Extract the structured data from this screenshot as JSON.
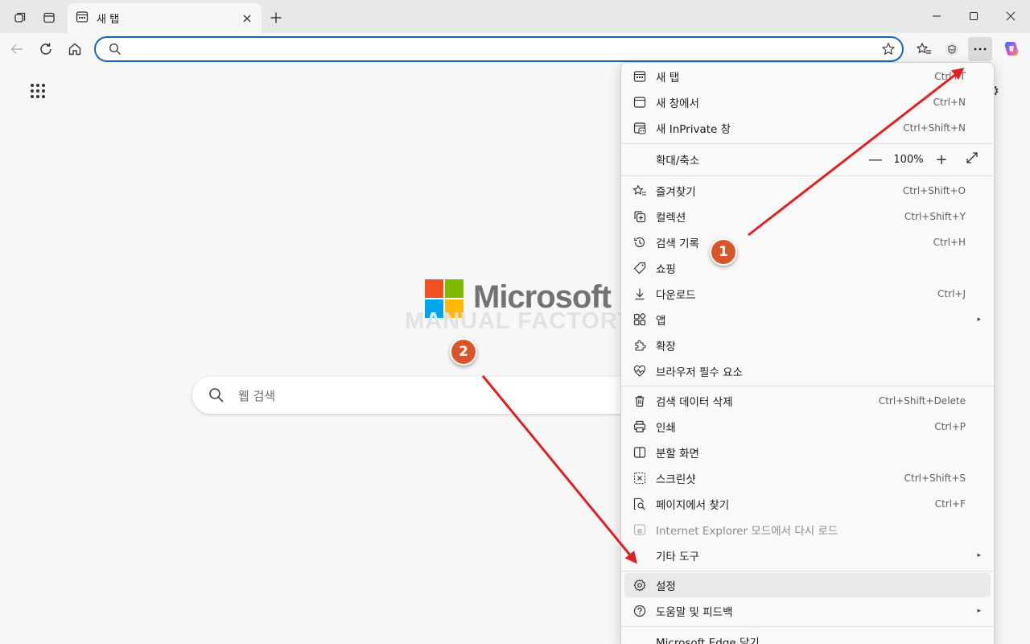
{
  "tab": {
    "title": "새 탭"
  },
  "omnibox": {
    "value": "",
    "placeholder": ""
  },
  "content": {
    "logo_text": "Microsoft",
    "watermark": "MANUAL FACTORY",
    "search_placeholder": "웹 검색"
  },
  "menu": {
    "items": [
      {
        "label": "새 탭",
        "shortcut": "Ctrl+T",
        "icon": "new-tab-icon"
      },
      {
        "label": "새 창에서",
        "shortcut": "Ctrl+N",
        "icon": "new-window-icon"
      },
      {
        "label": "새 InPrivate 창",
        "shortcut": "Ctrl+Shift+N",
        "icon": "inprivate-icon"
      },
      {
        "label": "확대/축소",
        "zoom_minus": "—",
        "zoom_value": "100%",
        "zoom_plus": "+",
        "icon": "fullscreen-icon"
      },
      {
        "label": "즐겨찾기",
        "shortcut": "Ctrl+Shift+O",
        "icon": "favorites-icon"
      },
      {
        "label": "컬렉션",
        "shortcut": "Ctrl+Shift+Y",
        "icon": "collections-icon"
      },
      {
        "label": "검색 기록",
        "shortcut": "Ctrl+H",
        "icon": "history-icon"
      },
      {
        "label": "쇼핑",
        "shortcut": "",
        "icon": "tag-icon"
      },
      {
        "label": "다운로드",
        "shortcut": "Ctrl+J",
        "icon": "download-icon"
      },
      {
        "label": "앱",
        "shortcut": "",
        "icon": "apps-icon",
        "submenu": "▸"
      },
      {
        "label": "확장",
        "shortcut": "",
        "icon": "extensions-icon"
      },
      {
        "label": "브라우저 필수 요소",
        "shortcut": "",
        "icon": "heartbeat-icon"
      },
      {
        "label": "검색 데이터 삭제",
        "shortcut": "Ctrl+Shift+Delete",
        "icon": "trash-icon"
      },
      {
        "label": "인쇄",
        "shortcut": "Ctrl+P",
        "icon": "print-icon"
      },
      {
        "label": "분할 화면",
        "shortcut": "",
        "icon": "split-screen-icon"
      },
      {
        "label": "스크린샷",
        "shortcut": "Ctrl+Shift+S",
        "icon": "screenshot-icon"
      },
      {
        "label": "페이지에서 찾기",
        "shortcut": "Ctrl+F",
        "icon": "find-icon"
      },
      {
        "label": "Internet Explorer 모드에서 다시 로드",
        "shortcut": "",
        "icon": "ie-icon"
      },
      {
        "label": "기타 도구",
        "shortcut": "",
        "icon": "",
        "submenu": "▸"
      },
      {
        "label": "설정",
        "shortcut": "",
        "icon": "gear-icon"
      },
      {
        "label": "도움말 및 피드백",
        "shortcut": "",
        "icon": "help-icon",
        "submenu": "▸"
      },
      {
        "label": "Microsoft Edge 닫기",
        "shortcut": "",
        "icon": ""
      }
    ]
  },
  "annotations": {
    "badge1": "1",
    "badge2": "2",
    "arrow_color": "#e02020"
  },
  "colors": {
    "accent": "#1565c0",
    "badge": "#d9552b"
  }
}
